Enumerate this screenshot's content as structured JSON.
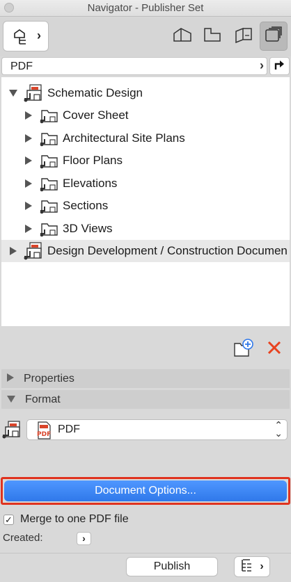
{
  "window": {
    "title": "Navigator - Publisher Set"
  },
  "path": {
    "current": "PDF"
  },
  "tree": {
    "root": {
      "label": "Schematic Design"
    },
    "children": [
      {
        "label": "Cover Sheet"
      },
      {
        "label": "Architectural Site Plans"
      },
      {
        "label": "Floor Plans"
      },
      {
        "label": "Elevations"
      },
      {
        "label": "Sections"
      },
      {
        "label": "3D Views"
      }
    ],
    "second_root": {
      "label": "Design Development / Construction Documen"
    }
  },
  "panels": {
    "properties": {
      "label": "Properties"
    },
    "format": {
      "label": "Format"
    }
  },
  "format": {
    "selected": "PDF"
  },
  "buttons": {
    "document_options": "Document Options...",
    "publish": "Publish"
  },
  "options": {
    "merge_label": "Merge to one PDF file",
    "merge_checked": true,
    "created_label": "Created:"
  },
  "colors": {
    "accent_blue": "#2f78ea",
    "highlight_red": "#e0331f",
    "delete_red": "#e8421f"
  }
}
